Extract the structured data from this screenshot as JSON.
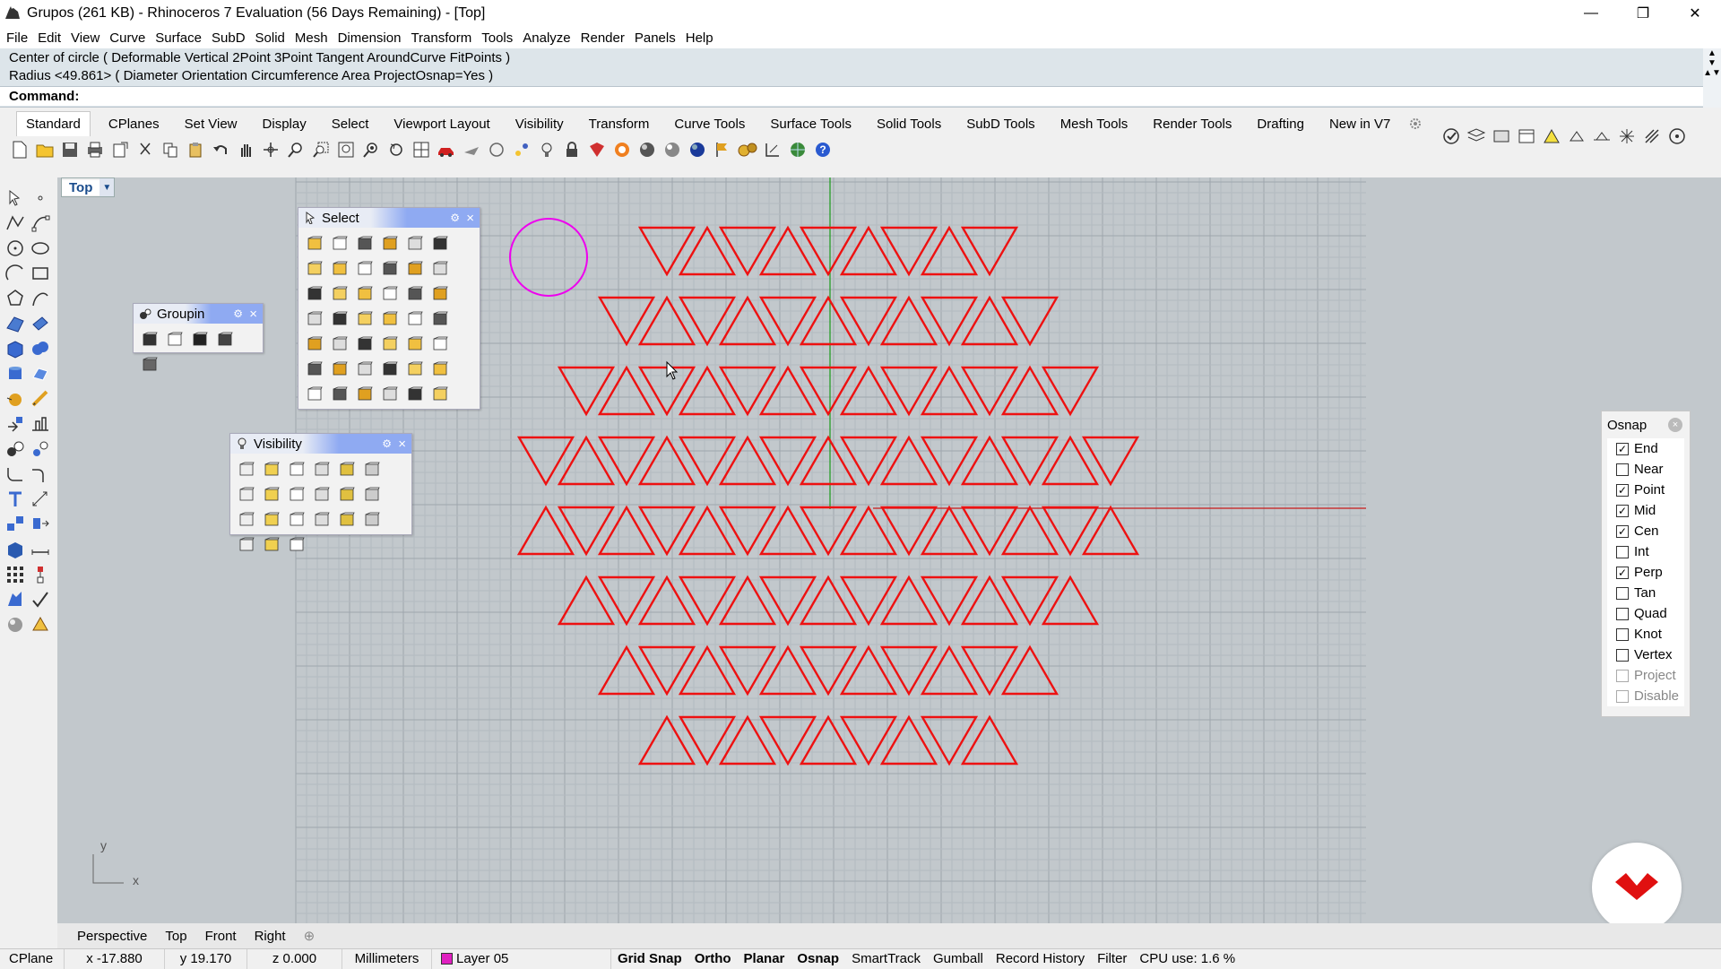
{
  "window": {
    "title": "Grupos (261 KB) - Rhinoceros 7 Evaluation (56 Days Remaining) - [Top]",
    "minimize_glyph": "—",
    "maximize_glyph": "❐",
    "close_glyph": "✕"
  },
  "menu": [
    "File",
    "Edit",
    "View",
    "Curve",
    "Surface",
    "SubD",
    "Solid",
    "Mesh",
    "Dimension",
    "Transform",
    "Tools",
    "Analyze",
    "Render",
    "Panels",
    "Help"
  ],
  "command": {
    "line1": "Center of circle ( Deformable  Vertical  2Point  3Point  Tangent  AroundCurve  FitPoints )",
    "line2": "Radius <49.861> ( Diameter  Orientation  Circumference  Area  ProjectOsnap=Yes )",
    "prompt": "Command:"
  },
  "toolbar_tabs": [
    "Standard",
    "CPlanes",
    "Set View",
    "Display",
    "Select",
    "Viewport Layout",
    "Visibility",
    "Transform",
    "Curve Tools",
    "Surface Tools",
    "Solid Tools",
    "SubD Tools",
    "Mesh Tools",
    "Render Tools",
    "Drafting",
    "New in V7"
  ],
  "active_tab": "Standard",
  "viewport": {
    "name": "Top",
    "dropdown_glyph": "▼",
    "axis_y": "y",
    "axis_x": "x"
  },
  "panels": {
    "select": {
      "title": "Select",
      "gear": "⚙",
      "close": "×"
    },
    "grouping": {
      "title": "Groupin",
      "gear": "⚙",
      "close": "×"
    },
    "visibility": {
      "title": "Visibility",
      "gear": "⚙",
      "close": "×"
    }
  },
  "osnap": {
    "title": "Osnap",
    "close": "×",
    "items": [
      {
        "label": "End",
        "checked": true
      },
      {
        "label": "Near",
        "checked": false
      },
      {
        "label": "Point",
        "checked": true
      },
      {
        "label": "Mid",
        "checked": true
      },
      {
        "label": "Cen",
        "checked": true
      },
      {
        "label": "Int",
        "checked": false
      },
      {
        "label": "Perp",
        "checked": true
      },
      {
        "label": "Tan",
        "checked": false
      },
      {
        "label": "Quad",
        "checked": false
      },
      {
        "label": "Knot",
        "checked": false
      },
      {
        "label": "Vertex",
        "checked": false
      },
      {
        "label": "Project",
        "checked": false,
        "disabled": true
      },
      {
        "label": "Disable",
        "checked": false,
        "disabled": true
      }
    ]
  },
  "viewport_tabs": [
    "Perspective",
    "Top",
    "Front",
    "Right"
  ],
  "viewport_tab_add": "⊕",
  "status": {
    "cplane": "CPlane",
    "x": "x -17.880",
    "y": "y 19.170",
    "z": "z 0.000",
    "units": "Millimeters",
    "layer": "Layer 05",
    "layer_color": "#e020c0",
    "grid_snap": "Grid Snap",
    "ortho": "Ortho",
    "planar": "Planar",
    "osnap": "Osnap",
    "smarttrack": "SmartTrack",
    "gumball": "Gumball",
    "record_history": "Record History",
    "filter": "Filter",
    "cpu": "CPU use: 1.6 %"
  },
  "colors": {
    "curve": "#ee1111",
    "circle": "#ee00ee",
    "grid_bg": "#c2c8cc",
    "y_axis": "#1a9a1a",
    "x_axis": "#c81a1a"
  },
  "triangle_grid": {
    "rows": [
      {
        "row": 0,
        "first_col": 3,
        "last_col": 11
      },
      {
        "row": 1,
        "first_col": 2,
        "last_col": 12
      },
      {
        "row": 2,
        "first_col": 1,
        "last_col": 13
      },
      {
        "row": 3,
        "first_col": 0,
        "last_col": 14
      },
      {
        "row": 4,
        "first_col": 0,
        "last_col": 14
      },
      {
        "row": 5,
        "first_col": 1,
        "last_col": 13
      },
      {
        "row": 6,
        "first_col": 2,
        "last_col": 12
      },
      {
        "row": 7,
        "first_col": 3,
        "last_col": 11
      }
    ]
  }
}
